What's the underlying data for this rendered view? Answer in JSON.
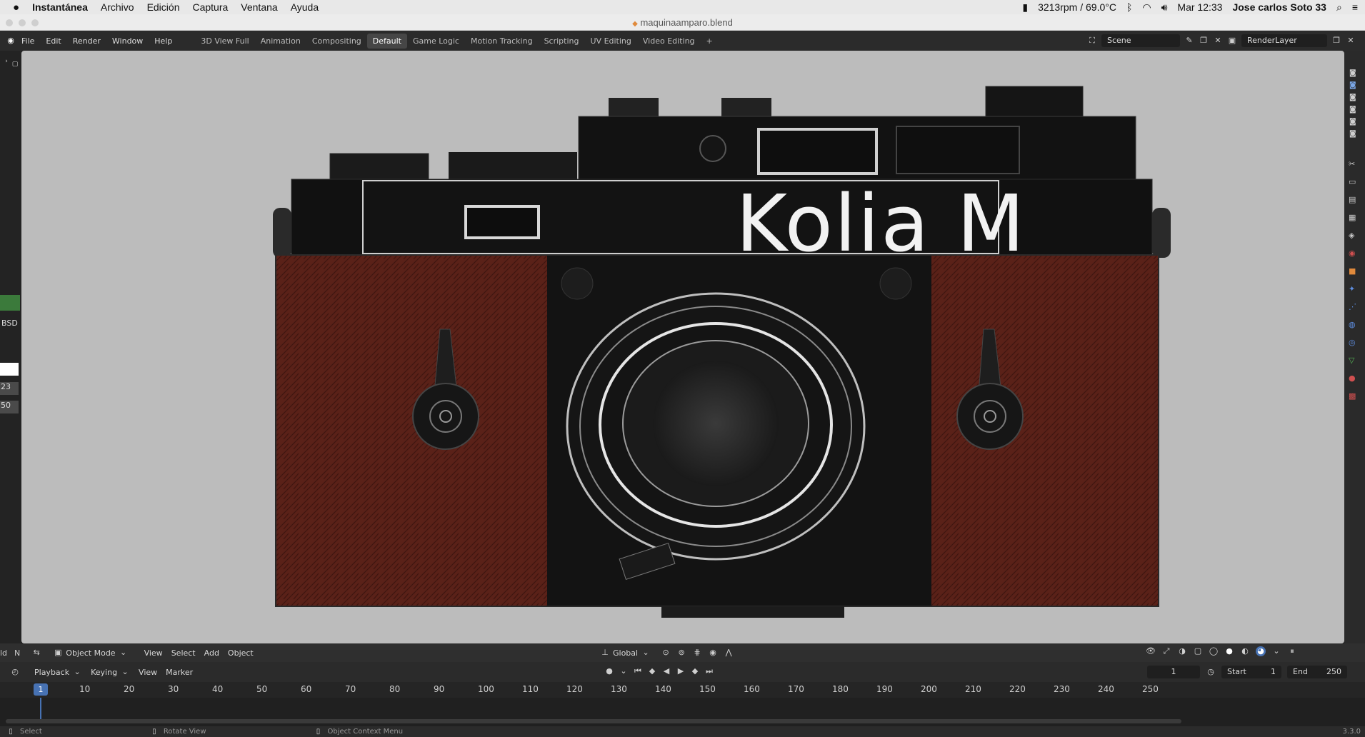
{
  "macbar": {
    "app": "Instantánea",
    "menus": [
      "Archivo",
      "Edición",
      "Captura",
      "Ventana",
      "Ayuda"
    ],
    "fan": "3213rpm / 69.0°C",
    "clock": "Mar 12:33",
    "user": "Jose carlos Soto 33"
  },
  "window": {
    "file_title": "maquinaamparo.blend"
  },
  "topbar": {
    "menus": [
      "File",
      "Edit",
      "Render",
      "Window",
      "Help"
    ],
    "workspaces": [
      "3D View Full",
      "Animation",
      "Compositing",
      "Default",
      "Game Logic",
      "Motion Tracking",
      "Scripting",
      "UV Editing",
      "Video Editing"
    ],
    "active_workspace": "Default",
    "add_label": "+",
    "scene": "Scene",
    "render_layer": "RenderLayer"
  },
  "leftpanel": {
    "labels": [
      "BSD",
      "23",
      "50"
    ]
  },
  "viewport": {
    "model_text": "Kolia M"
  },
  "vpheader": {
    "edge_labels": [
      "ld",
      "N"
    ],
    "mode": "Object Mode",
    "menus": [
      "View",
      "Select",
      "Add",
      "Object"
    ],
    "transform": "Global"
  },
  "timeline": {
    "menus": [
      "Playback",
      "Keying",
      "View",
      "Marker"
    ],
    "current_frame": "1",
    "start_label": "Start",
    "start_value": "1",
    "end_label": "End",
    "end_value": "250",
    "ruler_current": "1",
    "ticks": [
      "10",
      "20",
      "30",
      "40",
      "50",
      "60",
      "70",
      "80",
      "90",
      "100",
      "110",
      "120",
      "130",
      "140",
      "150",
      "160",
      "170",
      "180",
      "190",
      "200",
      "210",
      "220",
      "230",
      "240",
      "250"
    ]
  },
  "status": {
    "items": [
      "Select",
      "Rotate View",
      "Object Context Menu"
    ],
    "version": "3.3.0"
  },
  "colors": {
    "leather": "#5a2118",
    "body_black": "#151515",
    "viewport_bg": "#bcbcbc",
    "accent_blue": "#4772b3"
  }
}
